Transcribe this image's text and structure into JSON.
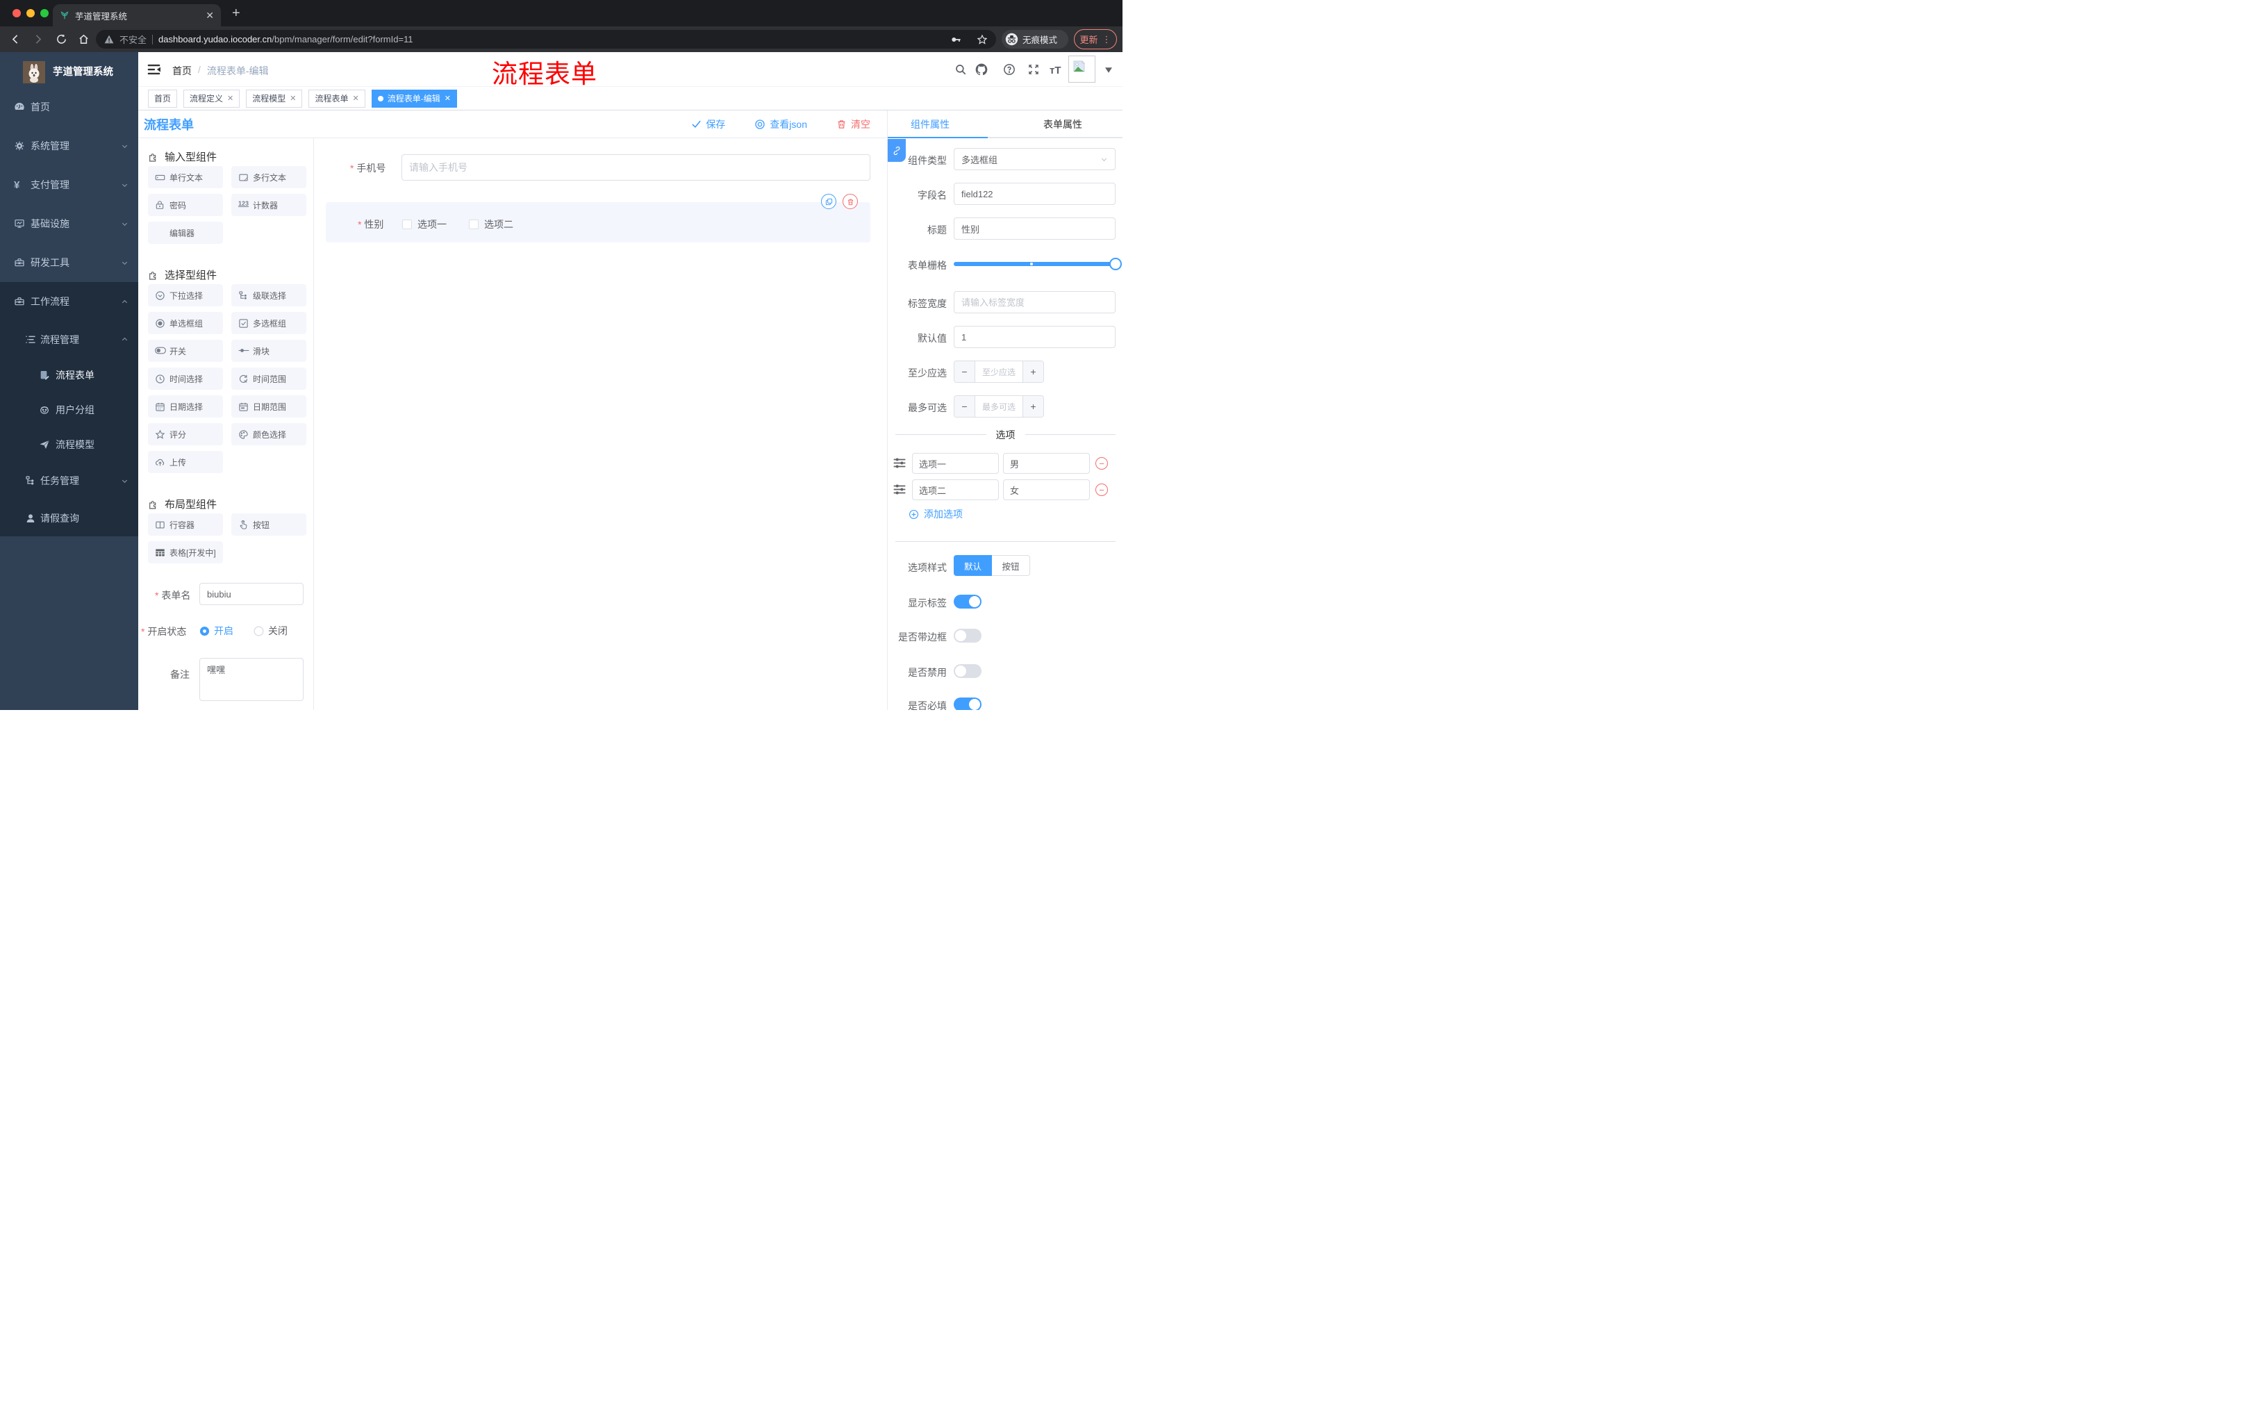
{
  "colors": {
    "primary": "#409EFF",
    "danger": "#F56C6C",
    "watermark": "#FF0000",
    "sidebar_bg": "#304156",
    "submenu_bg": "#1f2d3d"
  },
  "browser": {
    "tab_title": "芋道管理系统",
    "security_label": "不安全",
    "url_domain": "dashboard.yudao.iocoder.cn",
    "url_path": "/bpm/manager/form/edit?formId=11",
    "incognito_label": "无痕模式",
    "update_label": "更新"
  },
  "app": {
    "logo_title": "芋道管理系统",
    "watermark": "流程表单",
    "breadcrumb": {
      "home": "首页",
      "separator": "/",
      "current": "流程表单-编辑"
    },
    "sidebar": {
      "items": [
        {
          "label": "首页"
        },
        {
          "label": "系统管理"
        },
        {
          "label": "支付管理"
        },
        {
          "label": "基础设施"
        },
        {
          "label": "研发工具"
        },
        {
          "label": "工作流程"
        },
        {
          "label": "流程管理"
        },
        {
          "label": "流程表单"
        },
        {
          "label": "用户分组"
        },
        {
          "label": "流程模型"
        },
        {
          "label": "任务管理"
        },
        {
          "label": "请假查询"
        }
      ]
    },
    "tags": [
      {
        "label": "首页"
      },
      {
        "label": "流程定义"
      },
      {
        "label": "流程模型"
      },
      {
        "label": "流程表单"
      },
      {
        "label": "流程表单-编辑"
      }
    ],
    "designer": {
      "title": "流程表单",
      "actions": {
        "save": "保存",
        "view_json": "查看json",
        "clear": "清空"
      },
      "groups": [
        {
          "title": "输入型组件",
          "items": [
            {
              "label": "单行文本"
            },
            {
              "label": "多行文本"
            },
            {
              "label": "密码"
            },
            {
              "label": "计数器"
            },
            {
              "label": "编辑器"
            }
          ]
        },
        {
          "title": "选择型组件",
          "items": [
            {
              "label": "下拉选择"
            },
            {
              "label": "级联选择"
            },
            {
              "label": "单选框组"
            },
            {
              "label": "多选框组"
            },
            {
              "label": "开关"
            },
            {
              "label": "滑块"
            },
            {
              "label": "时间选择"
            },
            {
              "label": "时间范围"
            },
            {
              "label": "日期选择"
            },
            {
              "label": "日期范围"
            },
            {
              "label": "评分"
            },
            {
              "label": "颜色选择"
            },
            {
              "label": "上传"
            }
          ]
        },
        {
          "title": "布局型组件",
          "items": [
            {
              "label": "行容器"
            },
            {
              "label": "按钮"
            },
            {
              "label": "表格[开发中]"
            }
          ]
        }
      ],
      "meta": {
        "name_label": "表单名",
        "name_value": "biubiu",
        "status_label": "开启状态",
        "status_on": "开启",
        "status_off": "关闭",
        "remark_label": "备注",
        "remark_value": "嘿嘿"
      },
      "canvas": {
        "phone_label": "手机号",
        "phone_placeholder": "请输入手机号",
        "gender_label": "性别",
        "gender_opt1": "选项一",
        "gender_opt2": "选项二"
      },
      "props": {
        "tab_component": "组件属性",
        "tab_form": "表单属性",
        "type_label": "组件类型",
        "type_value": "多选框组",
        "field_label": "字段名",
        "field_value": "field122",
        "title_label": "标题",
        "title_value": "性别",
        "grid_label": "表单栅格",
        "width_label": "标签宽度",
        "width_placeholder": "请输入标签宽度",
        "default_label": "默认值",
        "default_value": "1",
        "min_label": "至少应选",
        "min_placeholder": "至少应选",
        "max_label": "最多可选",
        "max_placeholder": "最多可选",
        "options_title": "选项",
        "options": [
          {
            "label": "选项一",
            "value": "男"
          },
          {
            "label": "选项二",
            "value": "女"
          }
        ],
        "add_option": "添加选项",
        "style_label": "选项样式",
        "style_default": "默认",
        "style_button": "按钮",
        "switches": [
          {
            "label": "显示标签",
            "on": true
          },
          {
            "label": "是否带边框",
            "on": false
          },
          {
            "label": "是否禁用",
            "on": false
          },
          {
            "label": "是否必填",
            "on": true
          }
        ]
      }
    }
  }
}
